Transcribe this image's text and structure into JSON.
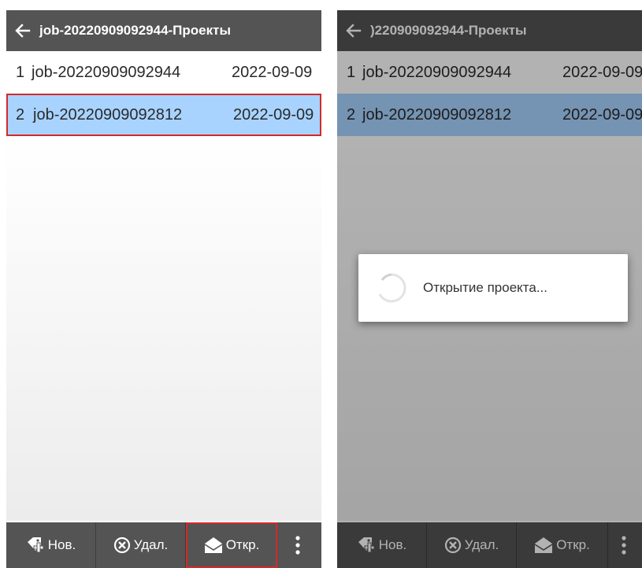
{
  "left": {
    "title": "job-20220909092944-Проекты",
    "rows": [
      {
        "num": "1",
        "name": "job-20220909092944",
        "date": "2022-09-09"
      },
      {
        "num": "2",
        "name": "job-20220909092812",
        "date": "2022-09-09"
      }
    ],
    "toolbar": {
      "new_label": "Нов.",
      "delete_label": "Удал.",
      "open_label": "Откр."
    }
  },
  "right": {
    "title": ")220909092944-Проекты",
    "rows": [
      {
        "num": "1",
        "name": "job-20220909092944",
        "date": "2022-09-09"
      },
      {
        "num": "2",
        "name": "job-20220909092812",
        "date": "2022-09-09"
      }
    ],
    "toolbar": {
      "new_label": "Нов.",
      "delete_label": "Удал.",
      "open_label": "Откр."
    },
    "dialog": {
      "message": "Открытие проекта..."
    }
  },
  "icons": {
    "back": "arrow-left-icon",
    "new": "add-tag-icon",
    "delete": "close-circle-icon",
    "open": "open-envelope-icon",
    "more": "more-vertical-icon",
    "loading": "spinner-icon"
  },
  "colors": {
    "title_bar": "#545454",
    "selected_row": "#a8d3ff",
    "highlight_border": "#d32a2a",
    "dimmed_overlay": "rgba(0,0,0,0.30)"
  }
}
